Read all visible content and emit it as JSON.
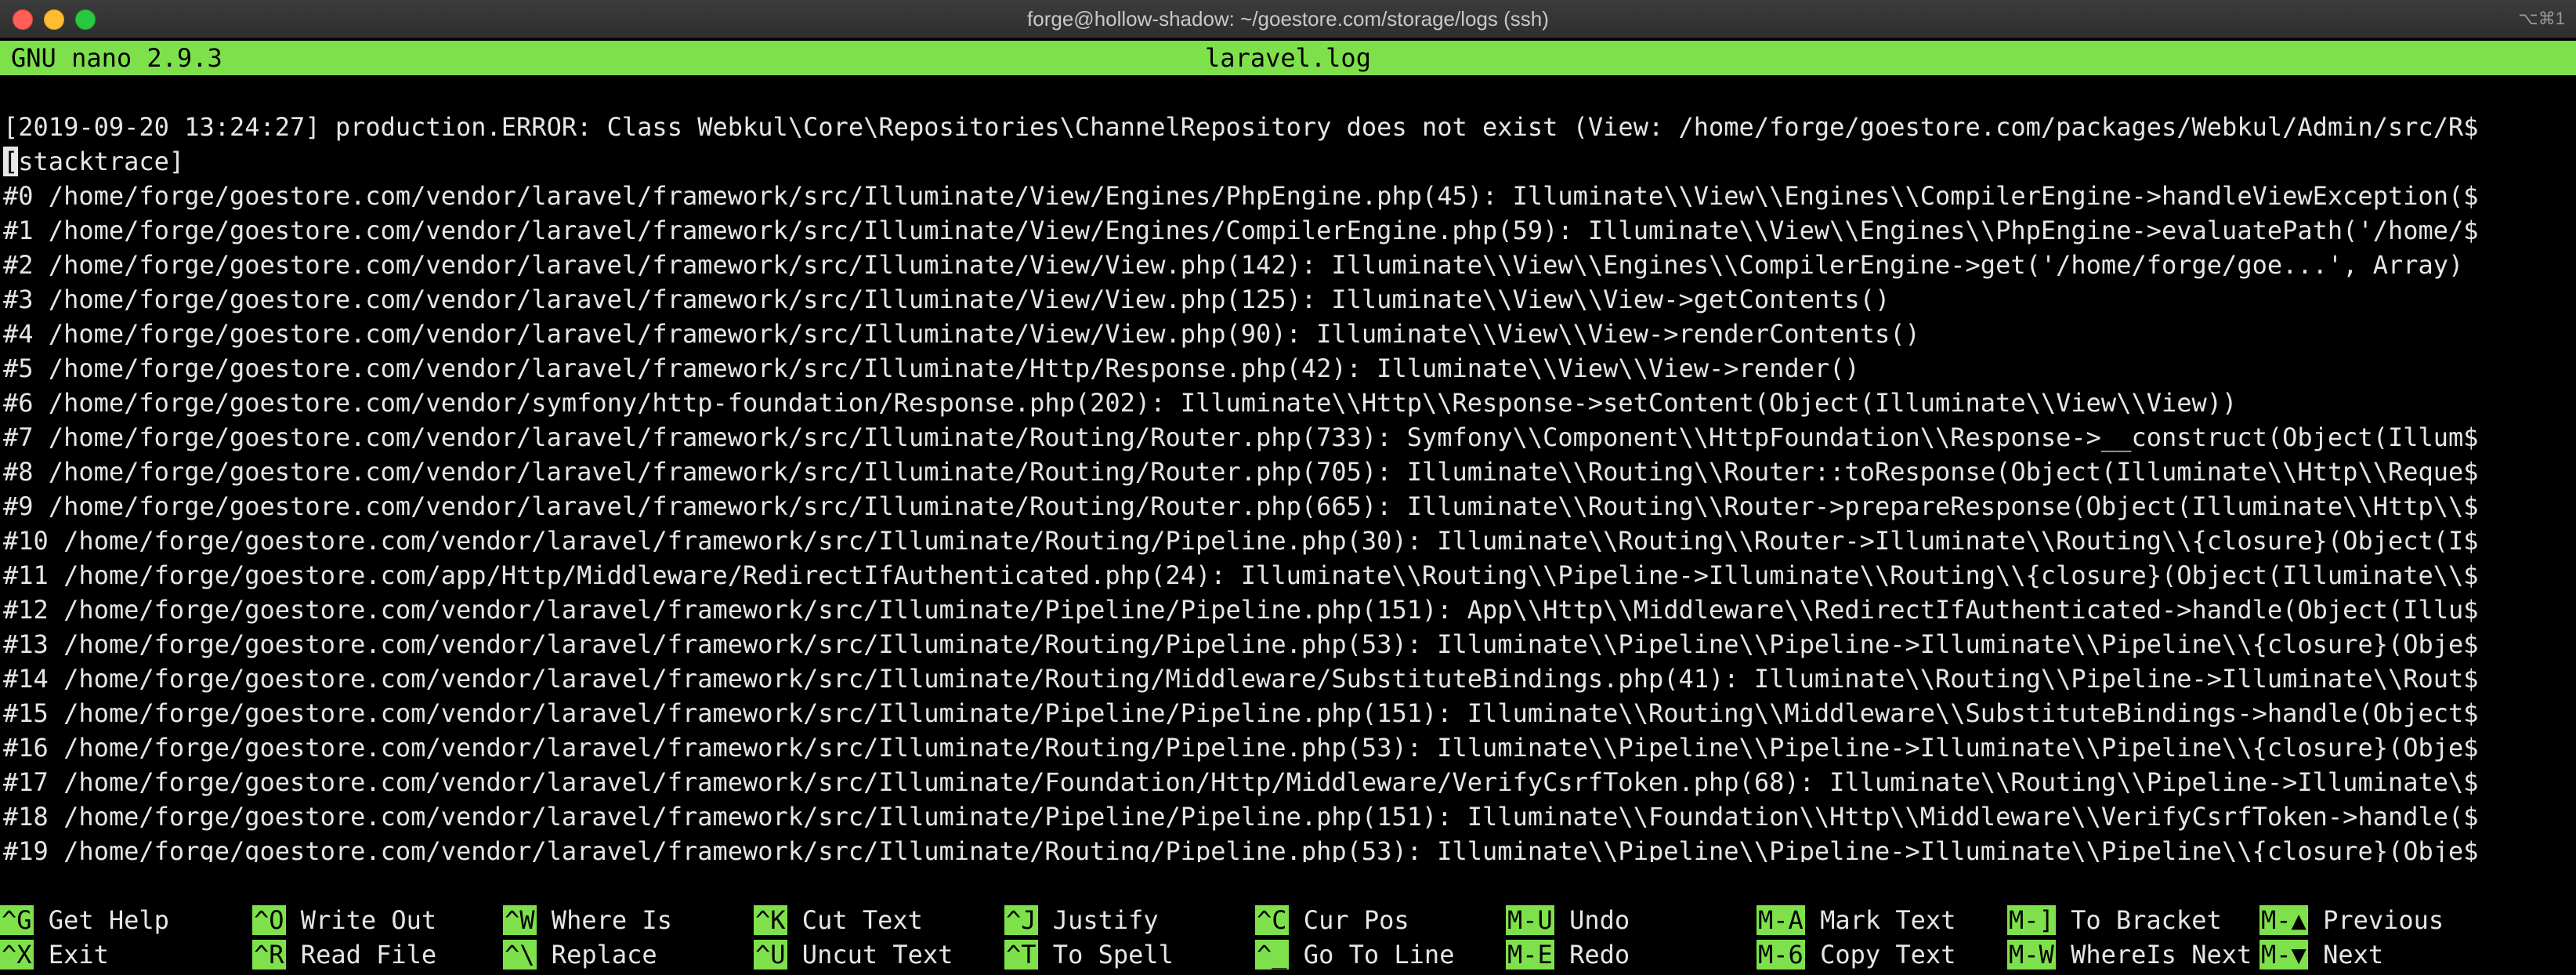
{
  "window": {
    "title": "forge@hollow-shadow: ~/goestore.com/storage/logs (ssh)",
    "shortcut": "⌥⌘1"
  },
  "nano": {
    "version": "GNU nano 2.9.3",
    "filename": "laravel.log"
  },
  "lines": [
    "[2019-09-20 13:24:27] production.ERROR: Class Webkul\\Core\\Repositories\\ChannelRepository does not exist (View: /home/forge/goestore.com/packages/Webkul/Admin/src/R$",
    "[stacktrace]",
    "#0 /home/forge/goestore.com/vendor/laravel/framework/src/Illuminate/View/Engines/PhpEngine.php(45): Illuminate\\\\View\\\\Engines\\\\CompilerEngine->handleViewException($",
    "#1 /home/forge/goestore.com/vendor/laravel/framework/src/Illuminate/View/Engines/CompilerEngine.php(59): Illuminate\\\\View\\\\Engines\\\\PhpEngine->evaluatePath('/home/$",
    "#2 /home/forge/goestore.com/vendor/laravel/framework/src/Illuminate/View/View.php(142): Illuminate\\\\View\\\\Engines\\\\CompilerEngine->get('/home/forge/goe...', Array)",
    "#3 /home/forge/goestore.com/vendor/laravel/framework/src/Illuminate/View/View.php(125): Illuminate\\\\View\\\\View->getContents()",
    "#4 /home/forge/goestore.com/vendor/laravel/framework/src/Illuminate/View/View.php(90): Illuminate\\\\View\\\\View->renderContents()",
    "#5 /home/forge/goestore.com/vendor/laravel/framework/src/Illuminate/Http/Response.php(42): Illuminate\\\\View\\\\View->render()",
    "#6 /home/forge/goestore.com/vendor/symfony/http-foundation/Response.php(202): Illuminate\\\\Http\\\\Response->setContent(Object(Illuminate\\\\View\\\\View))",
    "#7 /home/forge/goestore.com/vendor/laravel/framework/src/Illuminate/Routing/Router.php(733): Symfony\\\\Component\\\\HttpFoundation\\\\Response->__construct(Object(Illum$",
    "#8 /home/forge/goestore.com/vendor/laravel/framework/src/Illuminate/Routing/Router.php(705): Illuminate\\\\Routing\\\\Router::toResponse(Object(Illuminate\\\\Http\\\\Reque$",
    "#9 /home/forge/goestore.com/vendor/laravel/framework/src/Illuminate/Routing/Router.php(665): Illuminate\\\\Routing\\\\Router->prepareResponse(Object(Illuminate\\\\Http\\\\$",
    "#10 /home/forge/goestore.com/vendor/laravel/framework/src/Illuminate/Routing/Pipeline.php(30): Illuminate\\\\Routing\\\\Router->Illuminate\\\\Routing\\\\{closure}(Object(I$",
    "#11 /home/forge/goestore.com/app/Http/Middleware/RedirectIfAuthenticated.php(24): Illuminate\\\\Routing\\\\Pipeline->Illuminate\\\\Routing\\\\{closure}(Object(Illuminate\\\\$",
    "#12 /home/forge/goestore.com/vendor/laravel/framework/src/Illuminate/Pipeline/Pipeline.php(151): App\\\\Http\\\\Middleware\\\\RedirectIfAuthenticated->handle(Object(Illu$",
    "#13 /home/forge/goestore.com/vendor/laravel/framework/src/Illuminate/Routing/Pipeline.php(53): Illuminate\\\\Pipeline\\\\Pipeline->Illuminate\\\\Pipeline\\\\{closure}(Obje$",
    "#14 /home/forge/goestore.com/vendor/laravel/framework/src/Illuminate/Routing/Middleware/SubstituteBindings.php(41): Illuminate\\\\Routing\\\\Pipeline->Illuminate\\\\Rout$",
    "#15 /home/forge/goestore.com/vendor/laravel/framework/src/Illuminate/Pipeline/Pipeline.php(151): Illuminate\\\\Routing\\\\Middleware\\\\SubstituteBindings->handle(Object$",
    "#16 /home/forge/goestore.com/vendor/laravel/framework/src/Illuminate/Routing/Pipeline.php(53): Illuminate\\\\Pipeline\\\\Pipeline->Illuminate\\\\Pipeline\\\\{closure}(Obje$",
    "#17 /home/forge/goestore.com/vendor/laravel/framework/src/Illuminate/Foundation/Http/Middleware/VerifyCsrfToken.php(68): Illuminate\\\\Routing\\\\Pipeline->Illuminate\\$",
    "#18 /home/forge/goestore.com/vendor/laravel/framework/src/Illuminate/Pipeline/Pipeline.php(151): Illuminate\\\\Foundation\\\\Http\\\\Middleware\\\\VerifyCsrfToken->handle($",
    "#19 /home/forge/goestore.com/vendor/laravel/framework/src/Illuminate/Routing/Pipeline.php(53): Illuminate\\\\Pipeline\\\\Pipeline->Illuminate\\\\Pipeline\\\\{closure}(Obje$"
  ],
  "shortcuts": [
    {
      "key": "^G",
      "label": "Get Help"
    },
    {
      "key": "^X",
      "label": "Exit"
    },
    {
      "key": "^O",
      "label": "Write Out"
    },
    {
      "key": "^R",
      "label": "Read File"
    },
    {
      "key": "^W",
      "label": "Where Is"
    },
    {
      "key": "^\\",
      "label": "Replace"
    },
    {
      "key": "^K",
      "label": "Cut Text"
    },
    {
      "key": "^U",
      "label": "Uncut Text"
    },
    {
      "key": "^J",
      "label": "Justify"
    },
    {
      "key": "^T",
      "label": "To Spell"
    },
    {
      "key": "^C",
      "label": "Cur Pos"
    },
    {
      "key": "^_",
      "label": "Go To Line"
    },
    {
      "key": "M-U",
      "label": "Undo"
    },
    {
      "key": "M-E",
      "label": "Redo"
    },
    {
      "key": "M-A",
      "label": "Mark Text"
    },
    {
      "key": "M-6",
      "label": "Copy Text"
    },
    {
      "key": "M-]",
      "label": "To Bracket"
    },
    {
      "key": "M-W",
      "label": "WhereIs Next"
    },
    {
      "key": "M-▲",
      "label": "Previous"
    },
    {
      "key": "M-▼",
      "label": "Next"
    }
  ],
  "colors": {
    "nano_green": "#7ee14b",
    "terminal_bg": "#000000",
    "terminal_fg": "#e6e6e6"
  }
}
